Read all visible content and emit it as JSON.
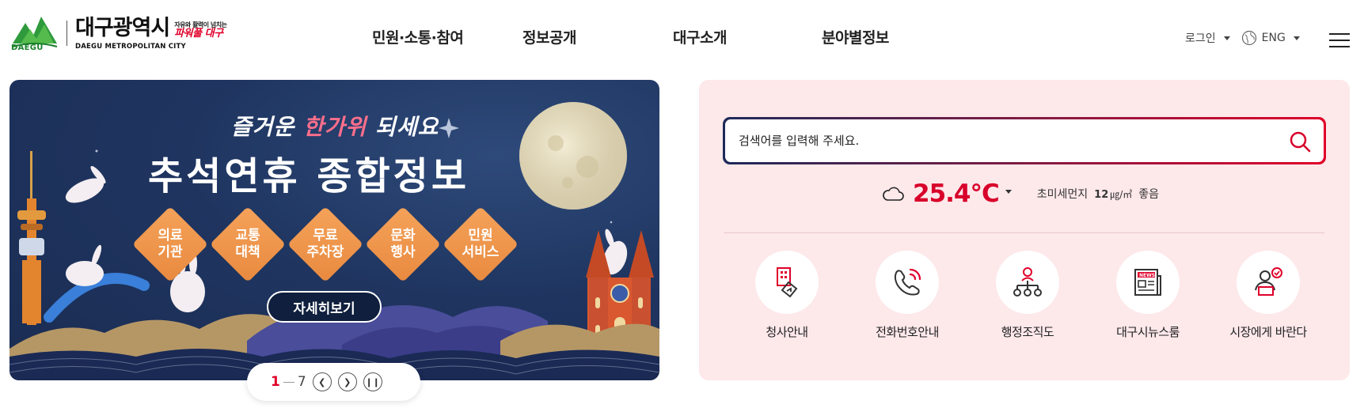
{
  "logo": {
    "emblem_text": "DAEGU",
    "name_kor": "대구광역시",
    "name_eng": "DAEGU METROPOLITAN CITY",
    "slogan_small": "자유와 활력이 넘치는",
    "slogan_big": "파워풀 대구"
  },
  "gnb": [
    {
      "label": "민원·소통·참여"
    },
    {
      "label": "정보공개"
    },
    {
      "label": "대구소개"
    },
    {
      "label": "분야별정보"
    }
  ],
  "util": {
    "login": "로그인",
    "lang": "ENG"
  },
  "banner": {
    "subtitle_pre": "즐거운 ",
    "subtitle_highlight": "한가위",
    "subtitle_post": " 되세요",
    "title": "추석연휴 종합정보",
    "items": [
      {
        "label": "의료\n기관"
      },
      {
        "label": "교통\n대책"
      },
      {
        "label": "무료\n주차장"
      },
      {
        "label": "문화\n행사"
      },
      {
        "label": "민원\n서비스"
      }
    ],
    "detail_button": "자세히보기",
    "pager": {
      "current": "1",
      "total": "7"
    }
  },
  "search": {
    "placeholder": "검색어를 입력해 주세요."
  },
  "weather": {
    "temperature": "25.4°C",
    "dust_label": "초미세먼지",
    "dust_value": "12",
    "dust_unit": "㎍/㎥",
    "dust_status": "좋음"
  },
  "quick_links": [
    {
      "label": "청사안내",
      "icon": "building-icon"
    },
    {
      "label": "전화번호안내",
      "icon": "phone-icon"
    },
    {
      "label": "행정조직도",
      "icon": "org-chart-icon"
    },
    {
      "label": "대구시뉴스룸",
      "icon": "news-icon"
    },
    {
      "label": "시장에게 바란다",
      "icon": "mayor-icon"
    }
  ],
  "colors": {
    "accent_red": "#e0002a",
    "panel_bg": "#fde8ea",
    "banner_navy": "#1f3560",
    "diamond_orange": "#f0964c"
  }
}
